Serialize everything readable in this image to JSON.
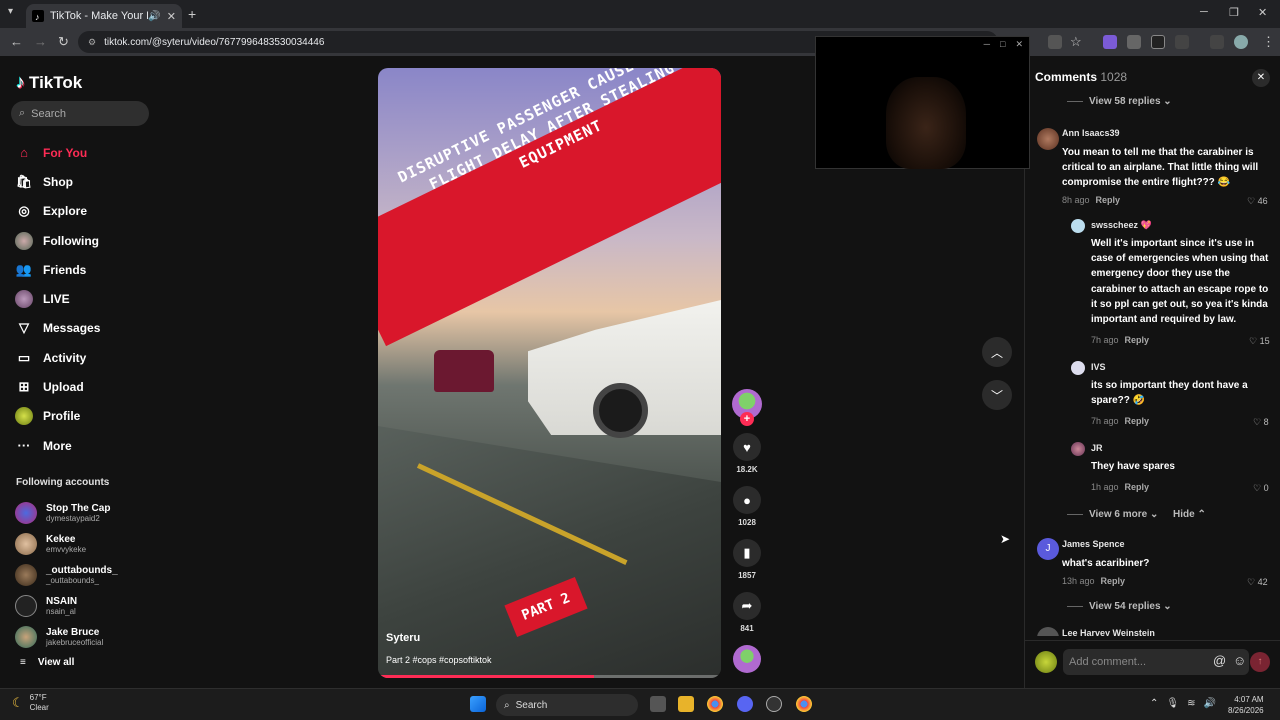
{
  "browser": {
    "tab_title": "TikTok - Make Your Day",
    "url": "tiktok.com/@syteru/video/7677996483530034446",
    "new_tab_symbol": "+"
  },
  "tiktok": {
    "logo": "TikTok",
    "search_placeholder": "Search",
    "nav": [
      {
        "label": "For You",
        "icon": "home-icon",
        "active": true
      },
      {
        "label": "Shop",
        "icon": "shop-icon"
      },
      {
        "label": "Explore",
        "icon": "compass-icon"
      },
      {
        "label": "Following",
        "icon": "following-avatar"
      },
      {
        "label": "Friends",
        "icon": "friends-icon"
      },
      {
        "label": "LIVE",
        "icon": "live-avatar"
      },
      {
        "label": "Messages",
        "icon": "send-icon"
      },
      {
        "label": "Activity",
        "icon": "inbox-icon"
      },
      {
        "label": "Upload",
        "icon": "upload-icon"
      },
      {
        "label": "Profile",
        "icon": "profile-avatar"
      },
      {
        "label": "More",
        "icon": "more-icon"
      }
    ],
    "following_title": "Following accounts",
    "following": [
      {
        "name": "Stop The Cap",
        "handle": "dymestaypaid2"
      },
      {
        "name": "Kekee",
        "handle": "emvvykeke"
      },
      {
        "name": "_outtabounds_",
        "handle": "_outtabounds_"
      },
      {
        "name": "NSAIN",
        "handle": "nsain_al"
      },
      {
        "name": "Jake Bruce",
        "handle": "jakebruceofficial"
      }
    ],
    "view_all": "View all"
  },
  "video": {
    "banner_text": "DISRUPTIVE PASSENGER CAUSES LONG FLIGHT DELAY AFTER STEALING EQUIPMENT",
    "part_label": "PART 2",
    "author": "Syteru",
    "caption": "Part 2 #cops #copsoftiktok",
    "progress": 0.63,
    "likes": "18.2K",
    "comments": "1028",
    "saves": "1857",
    "shares": "841"
  },
  "comments": {
    "title": "Comments",
    "count": "1028",
    "add_placeholder": "Add comment...",
    "items": [
      {
        "kind": "more",
        "text": "View 58 replies"
      },
      {
        "kind": "comment",
        "user": "Ann Isaacs39",
        "text": "You mean to tell me that the carabiner is critical to an airplane. That little thing will compromise the entire flight??? 😂",
        "time": "8h ago",
        "reply": "Reply",
        "likes": "46"
      },
      {
        "kind": "reply",
        "user": "swsscheez 💖",
        "text": "Well it's important since it's use in case of emergencies when using that emergency door they use the carabiner to attach an escape rope to it so ppl can get out, so yea it's kinda important and required by law.",
        "time": "7h ago",
        "reply": "Reply",
        "likes": "15"
      },
      {
        "kind": "reply",
        "user": "IVS",
        "text": "its so important they dont have a spare?? 🤣",
        "time": "7h ago",
        "reply": "Reply",
        "likes": "8"
      },
      {
        "kind": "reply",
        "user": "JR",
        "text": "They have spares",
        "time": "1h ago",
        "reply": "Reply",
        "likes": "0"
      },
      {
        "kind": "more",
        "text": "View 6 more",
        "hide": "Hide"
      },
      {
        "kind": "comment",
        "user": "James Spence",
        "text": "what's acaribiner?",
        "time": "13h ago",
        "reply": "Reply",
        "likes": "42"
      },
      {
        "kind": "more",
        "text": "View 54 replies"
      },
      {
        "kind": "comment_partial",
        "user": "Lee Harvey Weinstein"
      }
    ]
  },
  "taskbar": {
    "temp": "67°F",
    "weather": "Clear",
    "search": "Search",
    "time": "4:07 AM",
    "date": "8/26/2026"
  }
}
